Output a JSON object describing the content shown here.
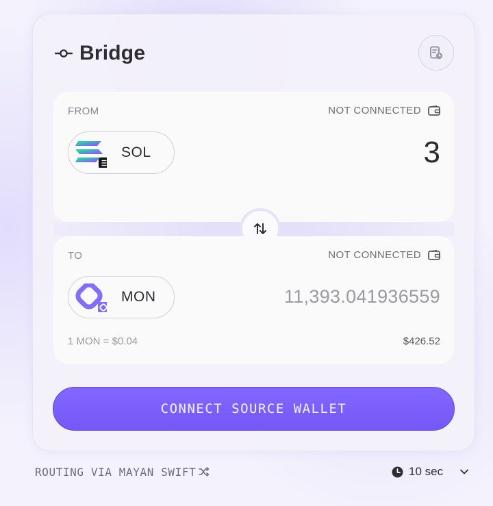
{
  "header": {
    "title": "Bridge"
  },
  "from": {
    "label": "FROM",
    "status": "NOT CONNECTED",
    "token_symbol": "SOL",
    "amount": "3"
  },
  "to": {
    "label": "TO",
    "status": "NOT CONNECTED",
    "token_symbol": "MON",
    "amount": "11,393.041936559",
    "rate": "1 MON = $0.04",
    "usd_value": "$426.52"
  },
  "actions": {
    "connect_label": "CONNECT SOURCE WALLET"
  },
  "footer": {
    "routing": "ROUTING VIA MAYAN SWIFT",
    "eta": "10 sec"
  },
  "colors": {
    "accent": "#7b5cfa",
    "solana_green": "#14f195",
    "solana_purple": "#9945ff",
    "monad_purple": "#836ef9"
  },
  "icons": [
    "commit-icon",
    "history-icon",
    "wallet-icon",
    "solana-logo",
    "monad-logo",
    "swap-arrows-icon",
    "shuffle-icon",
    "clock-icon",
    "chevron-down-icon"
  ]
}
